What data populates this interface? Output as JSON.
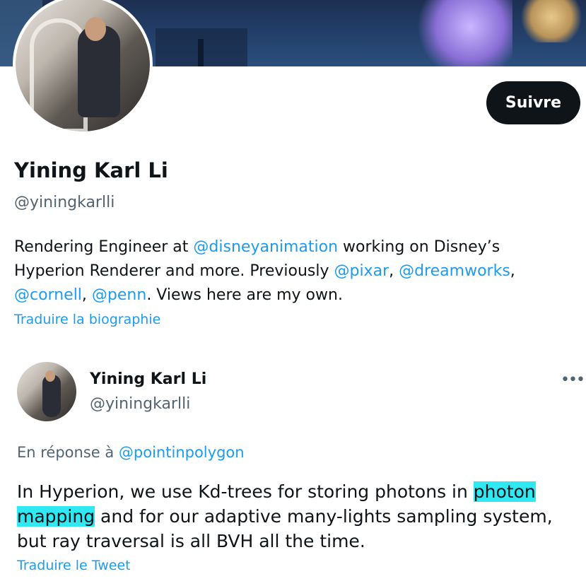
{
  "profile": {
    "name": "Yining Karl Li",
    "handle": "@yiningkarlli",
    "follow_label": "Suivre",
    "bio": {
      "t1": "Rendering Engineer at ",
      "m1": "@disneyanimation",
      "t2": " working on Disney’s Hyperion Renderer and more. Previously ",
      "m2": "@pixar",
      "t3": ", ",
      "m3": "@dreamworks",
      "t4": ", ",
      "m4": "@cornell",
      "t5": ", ",
      "m5": "@penn",
      "t6": ". Views here are my own."
    },
    "translate_bio": "Traduire la biographie"
  },
  "tweet": {
    "name": "Yining Karl Li",
    "handle": "@yiningkarlli",
    "more_icon": "•••",
    "reply_prefix": "En réponse à ",
    "reply_to": "@pointinpolygon",
    "text_before": "In Hyperion, we use Kd-trees for storing photons in ",
    "text_highlight": "photon mapping",
    "text_after": " and for our adaptive many-lights sampling system, but ray traversal is all BVH all the time.",
    "translate": "Traduire le Tweet"
  },
  "colors": {
    "accent": "#1d9bf0",
    "highlight": "#2fe8f2",
    "button_bg": "#0f1419",
    "secondary_text": "#536471"
  }
}
